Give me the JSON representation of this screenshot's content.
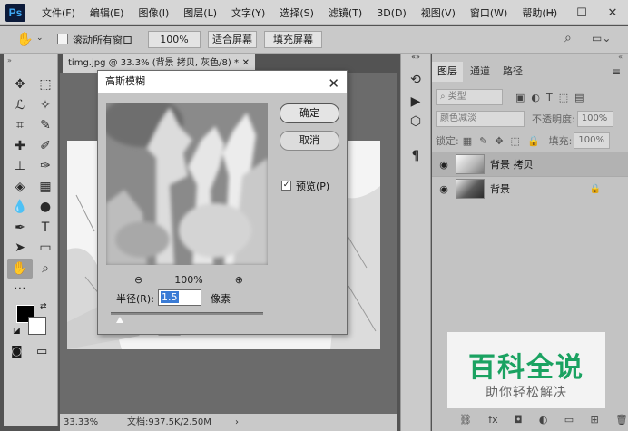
{
  "app": {
    "logo": "Ps"
  },
  "menu": [
    "文件(F)",
    "编辑(E)",
    "图像(I)",
    "图层(L)",
    "文字(Y)",
    "选择(S)",
    "滤镜(T)",
    "3D(D)",
    "视图(V)",
    "窗口(W)",
    "帮助(H)"
  ],
  "options_bar": {
    "scroll_all_label": "滚动所有窗口",
    "zoom_value": "100%",
    "fit_screen": "适合屏幕",
    "fill_screen": "填充屏幕"
  },
  "document": {
    "tab_title": "timg.jpg @ 33.3% (背景 拷贝, 灰色/8) *",
    "zoom_status": "33.33%",
    "doc_status": "文档:937.5K/2.50M"
  },
  "layers_panel": {
    "tabs": [
      "图层",
      "通道",
      "路径"
    ],
    "filter_kind": "类型",
    "blend_mode": "颜色减淡",
    "opacity_label": "不透明度:",
    "opacity_value": "100%",
    "lock_label": "锁定:",
    "fill_label": "填充:",
    "fill_value": "100%",
    "layers": [
      {
        "name": "背景 拷贝",
        "selected": true
      },
      {
        "name": "背景",
        "locked": true
      }
    ]
  },
  "dialog": {
    "title": "高斯模糊",
    "ok": "确定",
    "cancel": "取消",
    "preview_label": "预览(P)",
    "preview_checked": true,
    "zoom": "100%",
    "radius_label": "半径(R):",
    "radius_value": "1.5",
    "unit": "像素",
    "slider_fraction": 0.06
  },
  "watermark": {
    "title": "百科全说",
    "subtitle": "助你轻松解决"
  }
}
